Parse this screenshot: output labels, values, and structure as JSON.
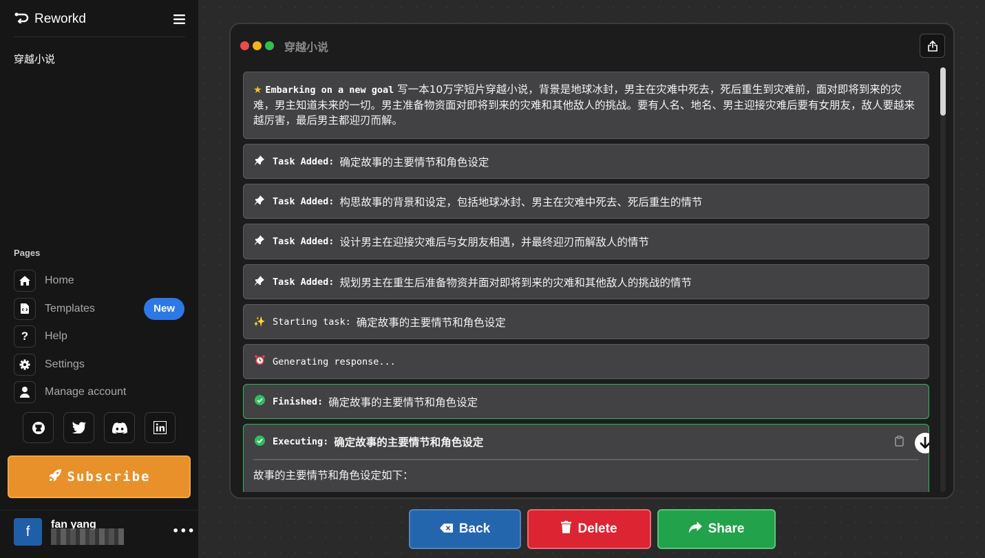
{
  "sidebar": {
    "brand": "Reworkd",
    "agent_name": "穿越小说",
    "pages_label": "Pages",
    "nav": [
      {
        "label": "Home",
        "icon": "home-icon"
      },
      {
        "label": "Templates",
        "icon": "file-code-icon",
        "badge": "New"
      },
      {
        "label": "Help",
        "icon": "question-icon"
      },
      {
        "label": "Settings",
        "icon": "gear-icon"
      },
      {
        "label": "Manage account",
        "icon": "user-icon"
      }
    ],
    "socials": [
      "github-icon",
      "twitter-icon",
      "discord-icon",
      "linkedin-icon"
    ],
    "subscribe_label": "Subscribe",
    "user": {
      "avatar_letter": "f",
      "name": "fan yang"
    }
  },
  "window": {
    "title": "穿越小说",
    "dot_colors": [
      "#ee4a4a",
      "#f1b51c",
      "#2fbf4f"
    ],
    "messages": {
      "goal": {
        "prefix": "Embarking on a new goal",
        "text": "写一本10万字短片穿越小说，背景是地球冰封，男主在灾难中死去，死后重生到灾难前，面对即将到来的灾难，男主知道未来的一切。男主准备物资面对即将到来的灾难和其他敌人的挑战。要有人名、地名、男主迎接灾难后要有女朋友，敌人要越来越厉害，最后男主都迎刃而解。"
      },
      "tasks": [
        {
          "prefix": "Task Added:",
          "text": "确定故事的主要情节和角色设定"
        },
        {
          "prefix": "Task Added:",
          "text": "构思故事的背景和设定，包括地球冰封、男主在灾难中死去、死后重生的情节"
        },
        {
          "prefix": "Task Added:",
          "text": "设计男主在迎接灾难后与女朋友相遇，并最终迎刃而解敌人的情节"
        },
        {
          "prefix": "Task Added:",
          "text": "规划男主在重生后准备物资并面对即将到来的灾难和其他敌人的挑战的情节"
        }
      ],
      "starting": {
        "prefix": "Starting task:",
        "text": "确定故事的主要情节和角色设定"
      },
      "generating": {
        "text": "Generating response..."
      },
      "finished": {
        "prefix": "Finished:",
        "text": "确定故事的主要情节和角色设定"
      },
      "executing": {
        "prefix": "Executing:",
        "text": "确定故事的主要情节和角色设定",
        "body": "故事的主要情节和角色设定如下："
      }
    }
  },
  "buttons": {
    "back": "Back",
    "delete": "Delete",
    "share": "Share"
  },
  "colors": {
    "accent_orange": "#e8902a",
    "back_blue": "#2466ad",
    "delete_red": "#dc2433",
    "share_green": "#22a24b",
    "finished_border": "#2fb85a"
  }
}
